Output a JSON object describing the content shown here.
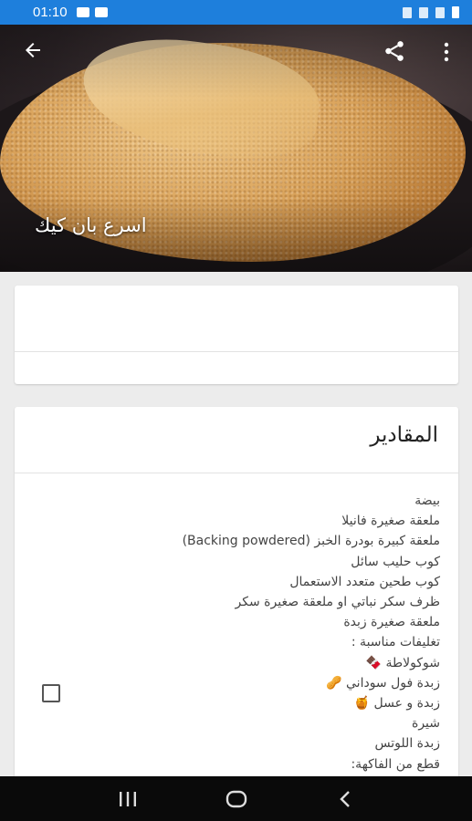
{
  "status_bar": {
    "time": "01:10"
  },
  "recipe": {
    "title": "اسرع بان كيك"
  },
  "ingredients_card": {
    "heading": "المقادير",
    "items": [
      "بيضة",
      "ملعقة صغيرة فانيلا",
      "ملعقة كبيرة بودرة الخبز (Backing powdered)",
      "كوب حليب سائل",
      "كوب طحين متعدد الاستعمال",
      "ظرف سكر نباتي او ملعقة صغيرة سكر",
      "ملعقة صغيرة زبدة",
      "تغليفات مناسبة :",
      "شوكولاطة 🍫",
      "زبدة فول سوداني 🥜",
      "زبدة و عسل 🍯",
      "شيرة",
      "زبدة اللوتس",
      "قطع من الفاكهة:"
    ]
  },
  "icons": {
    "back": "arrow-back-icon",
    "share": "share-icon",
    "more": "more-vert-icon",
    "nav_recents": "recents-icon",
    "nav_home": "home-icon",
    "nav_back": "nav-back-icon"
  }
}
